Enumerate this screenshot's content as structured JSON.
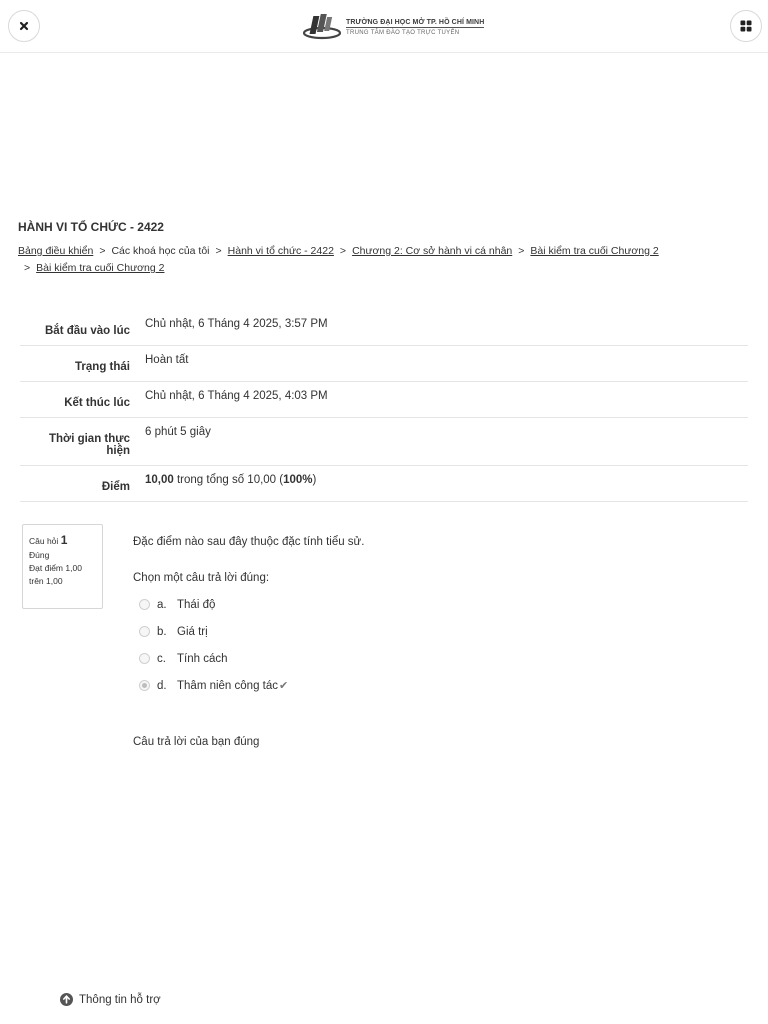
{
  "header": {
    "close_icon": "close-icon",
    "menu_icon": "grid-icon",
    "logo_line1": "TRƯỜNG ĐẠI HỌC MỞ TP. HỒ CHÍ MINH",
    "logo_line2": "TRUNG TÂM ĐÀO TẠO TRỰC TUYẾN"
  },
  "course": {
    "title": "HÀNH VI TỔ CHỨC - 2422"
  },
  "breadcrumb": {
    "items": [
      "Bảng điều khiển",
      "Các khoá học của tôi",
      "Hành vi tổ chức - 2422",
      "Chương 2: Cơ sở hành vi cá nhân",
      "Bài kiểm tra cuối Chương 2",
      "Bài kiểm tra cuối Chương 2"
    ],
    "separator": ">"
  },
  "summary": {
    "rows": [
      {
        "label": "Bắt đầu vào lúc",
        "value": "Chủ nhật, 6 Tháng 4 2025, 3:57 PM"
      },
      {
        "label": "Trạng thái",
        "value": "Hoàn tất"
      },
      {
        "label": "Kết thúc lúc",
        "value": "Chủ nhật, 6 Tháng 4 2025, 4:03 PM"
      },
      {
        "label": "Thời gian thực hiện",
        "value": "6 phút 5 giây"
      },
      {
        "label": "Điểm",
        "score_bold": "10,00",
        "score_mid": " trong tổng số 10,00 (",
        "score_percent": "100%",
        "score_end": ")"
      }
    ]
  },
  "question": {
    "info_label": "Câu hỏi",
    "number": "1",
    "status": "Đúng",
    "grade": "Đạt điểm 1,00 trên 1,00",
    "text": "Đặc điểm nào sau đây thuộc đặc tính tiểu sử.",
    "prompt": "Chọn một câu trả lời đúng:",
    "answers": [
      {
        "letter": "a.",
        "text": "Thái độ"
      },
      {
        "letter": "b.",
        "text": "Giá trị"
      },
      {
        "letter": "c.",
        "text": "Tính cách"
      },
      {
        "letter": "d.",
        "text": "Thâm niên công tác"
      }
    ],
    "selected": "d",
    "correct_mark": "✔",
    "feedback": "Câu trả lời của bạn đúng"
  },
  "footer": {
    "support_label": "Thông tin hỗ trợ"
  }
}
